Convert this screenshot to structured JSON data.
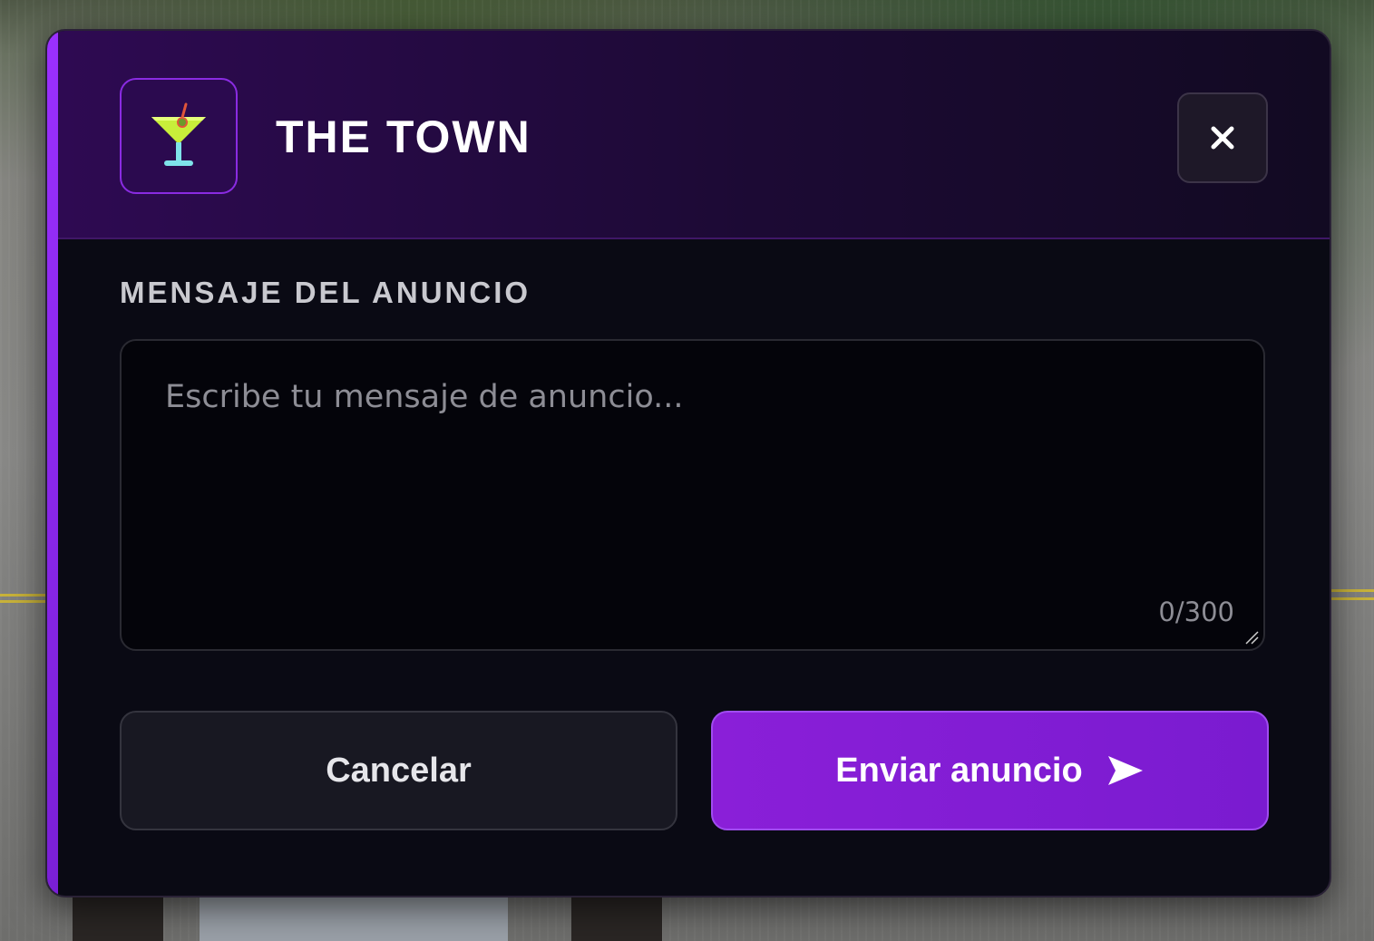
{
  "modal": {
    "title": "THE TOWN",
    "logo_icon": "cocktail-glass-icon",
    "close_icon": "close-icon",
    "accent_color": "#8a1fd8"
  },
  "form": {
    "label": "MENSAJE DEL ANUNCIO",
    "placeholder": "Escribe tu mensaje de anuncio...",
    "value": "",
    "counter": "0/300"
  },
  "actions": {
    "cancel_label": "Cancelar",
    "send_label": "Enviar anuncio",
    "send_icon": "send-arrow-icon"
  }
}
